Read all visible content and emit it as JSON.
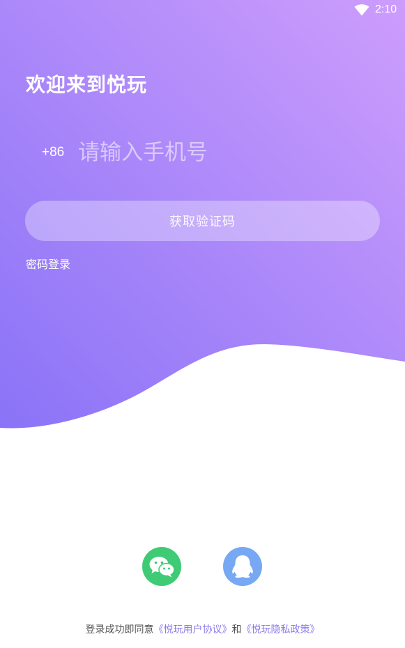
{
  "status_bar": {
    "time": "2:10",
    "wifi_icon": "wifi-icon"
  },
  "colors": {
    "gradient_top": "#c89bfb",
    "gradient_bottom": "#8c74f7",
    "wechat": "#3fcb75",
    "qq": "#77a8f3",
    "link": "#8a7bea"
  },
  "login": {
    "title": "欢迎来到悦玩",
    "country_code": "+86",
    "phone_placeholder": "请输入手机号",
    "phone_value": "",
    "get_code_label": "获取验证码",
    "password_login_label": "密码登录"
  },
  "social": {
    "wechat_icon": "wechat-icon",
    "qq_icon": "qq-icon"
  },
  "agreement": {
    "prefix": "登录成功即同意",
    "user_agreement": "《悦玩用户协议》",
    "conjunction": "和",
    "privacy_policy": "《悦玩隐私政策》"
  }
}
